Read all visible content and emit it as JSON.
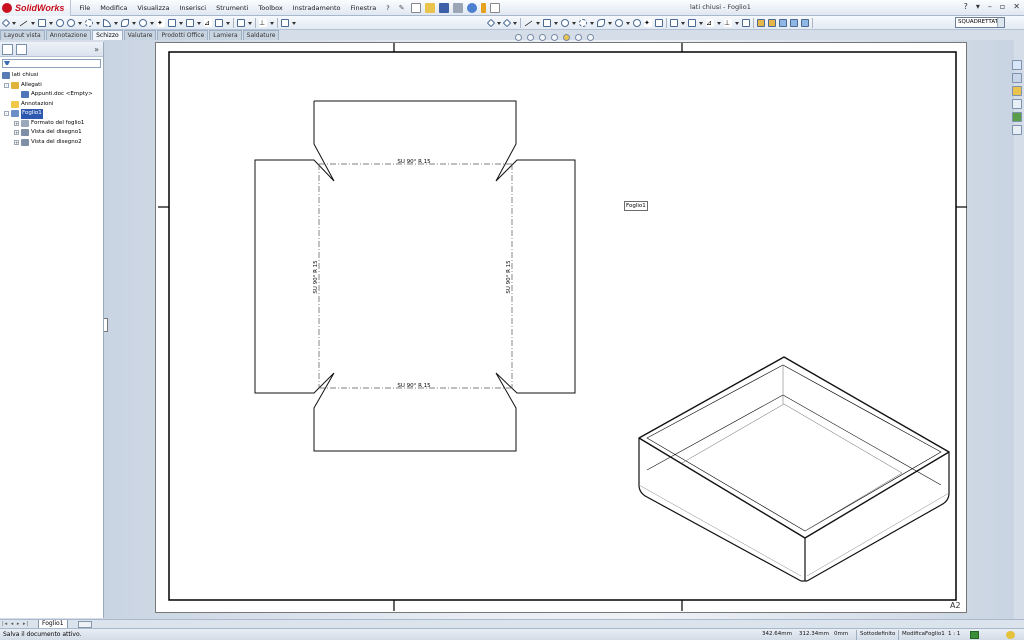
{
  "app": {
    "name": "SolidWorks",
    "window_title": "lati chiusi - Foglio1"
  },
  "menu": [
    "File",
    "Modifica",
    "Visualizza",
    "Inserisci",
    "Strumenti",
    "Toolbox",
    "Instradamento",
    "Finestra",
    "?"
  ],
  "toolbar": {
    "sheet_style": "SQUADRETTATURE"
  },
  "command_tabs": [
    {
      "label": "Layout vista",
      "active": false
    },
    {
      "label": "Annotazione",
      "active": false
    },
    {
      "label": "Schizzo",
      "active": true
    },
    {
      "label": "Valutare",
      "active": false
    },
    {
      "label": "Prodotti Office",
      "active": false
    },
    {
      "label": "Lamiera",
      "active": false
    },
    {
      "label": "Saldature",
      "active": false
    }
  ],
  "tree": [
    {
      "label": "lati chiusi",
      "level": 0,
      "expander": "",
      "icon": "drawing-icon"
    },
    {
      "label": "Allegati",
      "level": 1,
      "expander": "-",
      "icon": "attachment-icon"
    },
    {
      "label": "Appunti.doc <Empty>",
      "level": 2,
      "expander": "",
      "icon": "document-icon"
    },
    {
      "label": "Annotazioni",
      "level": 1,
      "expander": "",
      "icon": "annotations-icon"
    },
    {
      "label": "Foglio1",
      "level": 1,
      "expander": "-",
      "icon": "sheet-icon",
      "selected": true
    },
    {
      "label": "Formato del foglio1",
      "level": 2,
      "expander": "+",
      "icon": "sheet-format-icon"
    },
    {
      "label": "Vista del disegno1",
      "level": 2,
      "expander": "+",
      "icon": "drawing-view-icon"
    },
    {
      "label": "Vista del disegno2",
      "level": 2,
      "expander": "+",
      "icon": "drawing-view-icon"
    }
  ],
  "drawing": {
    "bend_note": "SU 90° R 15",
    "sheet_tag": "Foglio1",
    "sheet_size": "A2"
  },
  "sheet_tab": "Foglio1",
  "status": {
    "message": "Salva il documento attivo.",
    "x": "342.64mm",
    "y": "312.34mm",
    "z": "0mm",
    "state": "Sottodefinito",
    "mode": "ModificaFoglio1",
    "scale": "1 : 1"
  }
}
